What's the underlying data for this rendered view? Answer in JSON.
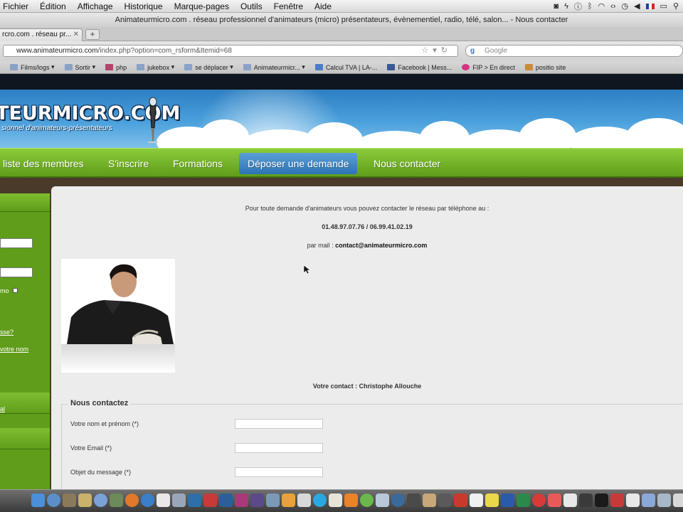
{
  "menubar": {
    "items": [
      "Fichier",
      "Édition",
      "Affichage",
      "Historique",
      "Marque-pages",
      "Outils",
      "Fenêtre",
      "Aide"
    ]
  },
  "window": {
    "title": "Animateurmicro.com . réseau professionnel d'animateurs (micro) présentateurs, évènementiel, radio, télé, salon... - Nous contacter"
  },
  "tab": {
    "label": "rcro.com . réseau pr..."
  },
  "url": {
    "domain": "www.animateurmicro.com",
    "path": "/index.php?option=com_rsform&Itemid=68"
  },
  "search": {
    "placeholder": "Google"
  },
  "bookmarks": [
    {
      "label": "Films/logs",
      "icon": "folder-icon"
    },
    {
      "label": "Sortir",
      "icon": "folder-icon"
    },
    {
      "label": "php",
      "icon": "php-icon"
    },
    {
      "label": "jukebox",
      "icon": "folder-icon"
    },
    {
      "label": "se déplacer",
      "icon": "folder-icon"
    },
    {
      "label": "Animateurmicr...",
      "icon": "folder-icon"
    },
    {
      "label": "Calcul TVA | LA-...",
      "icon": "tva-icon"
    },
    {
      "label": "Facebook | Mess...",
      "icon": "facebook-icon"
    },
    {
      "label": "FIP > En direct",
      "icon": "fip-icon"
    },
    {
      "label": "positio site",
      "icon": "bookmark-icon"
    }
  ],
  "site": {
    "logo_text": "TEURMICRO.COM",
    "logo_sub": "sionnel d'animateurs-présentateurs",
    "nav": [
      {
        "label": "liste des membres"
      },
      {
        "label": "S'inscrire"
      },
      {
        "label": "Formations"
      },
      {
        "label": "Déposer une demande"
      },
      {
        "label": "Nous contacter"
      }
    ],
    "sidebar": {
      "remember": "mo",
      "link1": "sse?",
      "link2": "votre nom",
      "link3": "al"
    }
  },
  "content": {
    "intro": "Pour toute demande d'animateurs vous pouvez contacter le réseau par téléphone au :",
    "phone": "01.48.97.07.76 / 06.99.41.02.19",
    "mail_label": "par mail :",
    "mail": "contact@animateurmicro.com",
    "contact": "Votre contact : Christophe Allouche",
    "form": {
      "legend": "Nous contactez",
      "fields": [
        {
          "label": "Votre nom et prénom (*)"
        },
        {
          "label": "Votre Email (*)"
        },
        {
          "label": "Objet du message (*)"
        }
      ]
    }
  },
  "colors": {
    "nav_green": "#6fae22",
    "nav_active": "#3f86c6",
    "sky": "#4aa0dc"
  }
}
